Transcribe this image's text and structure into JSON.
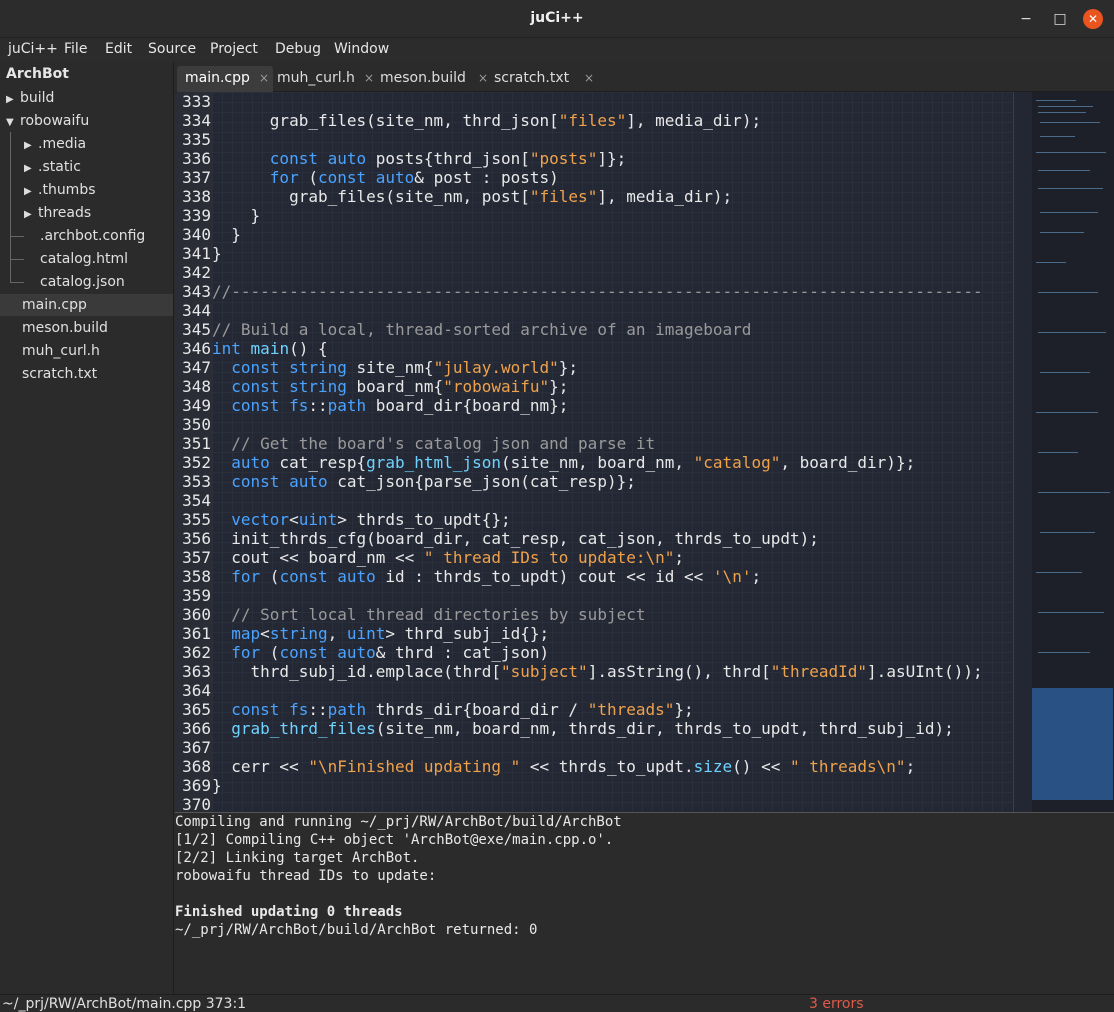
{
  "window": {
    "title": "juCi++"
  },
  "menu": [
    "juCi++",
    "File",
    "Edit",
    "Source",
    "Project",
    "Debug",
    "Window"
  ],
  "sidebar": {
    "root": "ArchBot",
    "items": [
      {
        "label": "build",
        "expander": "▶"
      },
      {
        "label": "robowaifu",
        "expander": "▼"
      },
      {
        "label": ".media",
        "expander": "▶"
      },
      {
        "label": ".static",
        "expander": "▶"
      },
      {
        "label": ".thumbs",
        "expander": "▶"
      },
      {
        "label": "threads",
        "expander": "▶"
      },
      {
        "label": ".archbot.config"
      },
      {
        "label": "catalog.html"
      },
      {
        "label": "catalog.json"
      },
      {
        "label": "main.cpp"
      },
      {
        "label": "meson.build"
      },
      {
        "label": "muh_curl.h"
      },
      {
        "label": "scratch.txt"
      }
    ]
  },
  "tabs": [
    {
      "label": "main.cpp",
      "close": "×"
    },
    {
      "label": "muh_curl.h",
      "close": "×"
    },
    {
      "label": "meson.build",
      "close": "×"
    },
    {
      "label": "scratch.txt",
      "close": "×"
    }
  ],
  "editor": {
    "line_numbers": [
      "333",
      "334",
      "335",
      "336",
      "337",
      "338",
      "339",
      "340",
      "341",
      "342",
      "343",
      "344",
      "345",
      "346",
      "347",
      "348",
      "349",
      "350",
      "351",
      "352",
      "353",
      "354",
      "355",
      "356",
      "357",
      "358",
      "359",
      "360",
      "361",
      "362",
      "363",
      "364",
      "365",
      "366",
      "367",
      "368",
      "369",
      "370"
    ]
  },
  "terminal": {
    "lines": [
      "Compiling and running ~/_prj/RW/ArchBot/build/ArchBot",
      "[1/2] Compiling C++ object 'ArchBot@exe/main.cpp.o'.",
      "[2/2] Linking target ArchBot.",
      "robowaifu thread IDs to update:",
      "",
      "Finished updating 0 threads",
      "~/_prj/RW/ArchBot/build/ArchBot returned: 0"
    ]
  },
  "status": {
    "path": "~/_prj/RW/ArchBot/main.cpp 373:1",
    "errors": "3 errors"
  },
  "colors": {
    "keyword": "#4aa3ff",
    "string": "#f0a24a",
    "comment": "#9a9a9a",
    "error": "#e05a4a",
    "close": "#e9541f"
  }
}
